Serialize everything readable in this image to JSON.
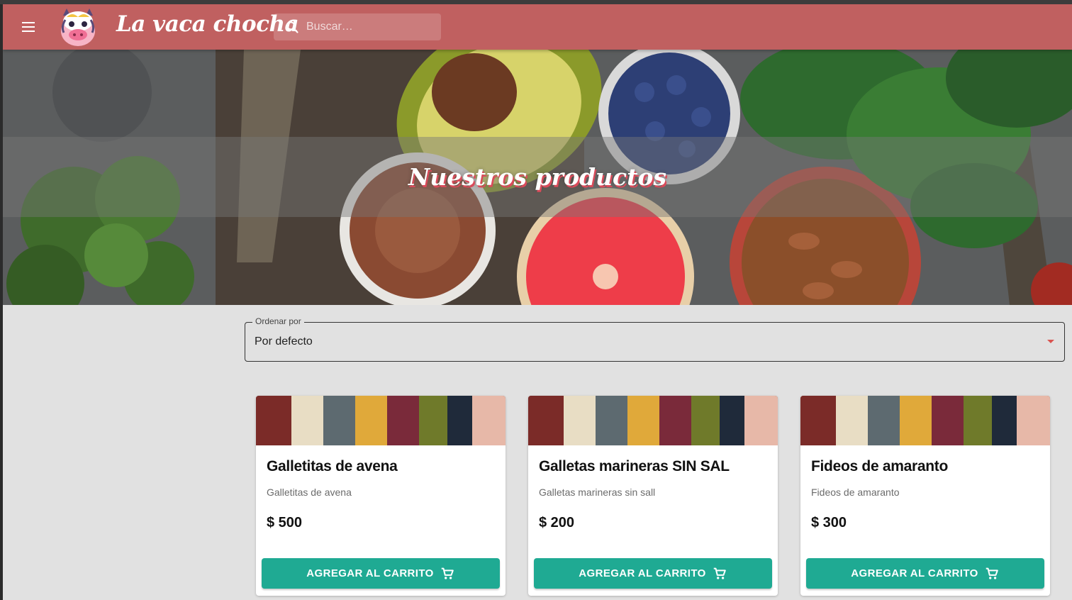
{
  "header": {
    "brand": "La vaca chocha",
    "menu_icon": "menu-icon",
    "logo_icon": "cow-logo-icon",
    "search": {
      "placeholder": "Buscar…",
      "value": "",
      "icon": "search-icon"
    }
  },
  "hero": {
    "title": "Nuestros productos"
  },
  "sort": {
    "label": "Ordenar por",
    "value": "Por defecto",
    "icon": "dropdown-arrow-icon"
  },
  "products": [
    {
      "title": "Galletitas de avena",
      "description": "Galletitas de avena",
      "price": "$ 500",
      "button": "AGREGAR AL CARRITO"
    },
    {
      "title": "Galletas marineras SIN SAL",
      "description": "Galletas marineras sin sall",
      "price": "$ 200",
      "button": "AGREGAR AL CARRITO"
    },
    {
      "title": "Fideos de amaranto",
      "description": "Fideos de amaranto",
      "price": "$ 300",
      "button": "AGREGAR AL CARRITO"
    }
  ],
  "colors": {
    "appbar": "#c06060",
    "accent_button": "#1faa93",
    "title_shadow": "#d94b5a",
    "background": "#e1e1e1"
  }
}
